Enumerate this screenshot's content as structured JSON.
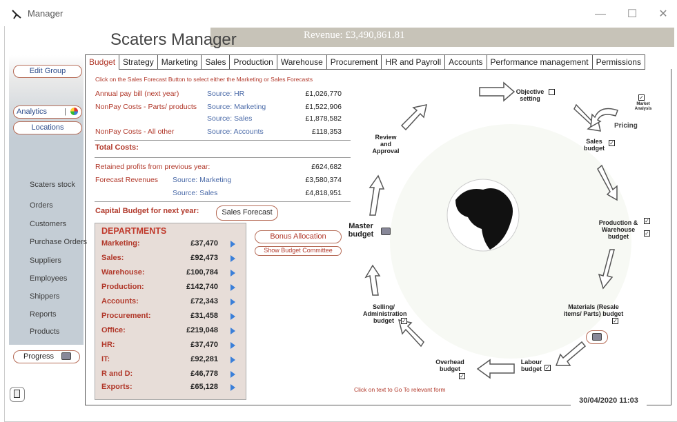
{
  "window": {
    "title": "Manager",
    "minimize": "—",
    "maximize": "☐",
    "close": "✕"
  },
  "app": {
    "heading": "Scaters Manager",
    "revenue": "Revenue: £3,490,861.81"
  },
  "sidebar": {
    "edit_group": "Edit Group",
    "analytics": "Analytics",
    "locations": "Locations",
    "items": [
      "Scaters stock",
      "Orders",
      "Customers",
      "Purchase Orders",
      "Suppliers",
      "Employees",
      "Shippers",
      "Reports",
      "Products"
    ],
    "progress": "Progress"
  },
  "tabs": [
    "Budget",
    "Strategy",
    "Marketing",
    "Sales",
    "Production",
    "Warehouse",
    "Procurement",
    "HR and Payroll",
    "Accounts",
    "Performance management",
    "Permissions"
  ],
  "budget": {
    "hint": "Click on the Sales Forecast Button to select either the Marketing or Sales Forecasts",
    "rows": [
      {
        "label": "Annual pay bill (next year)",
        "source": "Source: HR",
        "value": "£1,026,770"
      },
      {
        "label": "NonPay Costs - Parts/ products",
        "source": "Source: Marketing",
        "value": "£1,522,906"
      },
      {
        "label": "",
        "source": "Source: Sales",
        "value": "£1,878,582"
      },
      {
        "label": "NonPay Costs - All other",
        "source": "Source: Accounts",
        "value": "£118,353"
      }
    ],
    "total_costs": "Total Costs:",
    "retained_label": "Retained profits from previous year:",
    "retained_value": "£624,682",
    "forecast_label": "Forecast Revenues",
    "forecast_rows": [
      {
        "source": "Source: Marketing",
        "value": "£3,580,374"
      },
      {
        "source": "Source: Sales",
        "value": "£4,818,951"
      }
    ],
    "capital_label": "Capital Budget for next year:",
    "sales_forecast_btn": "Sales Forecast",
    "bonus_btn": "Bonus Allocation",
    "committee_btn": "Show Budget Committee"
  },
  "departments": {
    "title": "DEPARTMENTS",
    "items": [
      {
        "name": "Marketing:",
        "value": "£37,470"
      },
      {
        "name": "Sales:",
        "value": "£92,473"
      },
      {
        "name": "Warehouse:",
        "value": "£100,784"
      },
      {
        "name": "Production:",
        "value": "£142,740"
      },
      {
        "name": "Accounts:",
        "value": "£72,343"
      },
      {
        "name": "Procurement:",
        "value": "£31,458"
      },
      {
        "name": "Office:",
        "value": "£219,048"
      },
      {
        "name": "HR:",
        "value": "£37,470"
      },
      {
        "name": "IT:",
        "value": "£92,281"
      },
      {
        "name": "R and D:",
        "value": "£46,778"
      },
      {
        "name": "Exports:",
        "value": "£65,128"
      }
    ]
  },
  "diagram": {
    "objective": "Objective setting",
    "market": "Market Analysis",
    "pricing": "Pricing",
    "sales_budget": "Sales budget",
    "production": "Production & Warehouse budget",
    "materials": "Materials (Resale items/ Parts) budget",
    "labour": "Labour budget",
    "overhead": "Overhead budget",
    "selling": "Selling/ Administration budget",
    "master": "Master budget",
    "review": "Review and Approval",
    "footer_hint": "Click on text to Go To relevant form"
  },
  "status": {
    "datetime": "30/04/2020 11:03"
  },
  "colors": {
    "accent": "#b1382a",
    "link": "#4a6aa8",
    "sidebar": "#c4cdd5",
    "header": "#c7c3b8"
  }
}
